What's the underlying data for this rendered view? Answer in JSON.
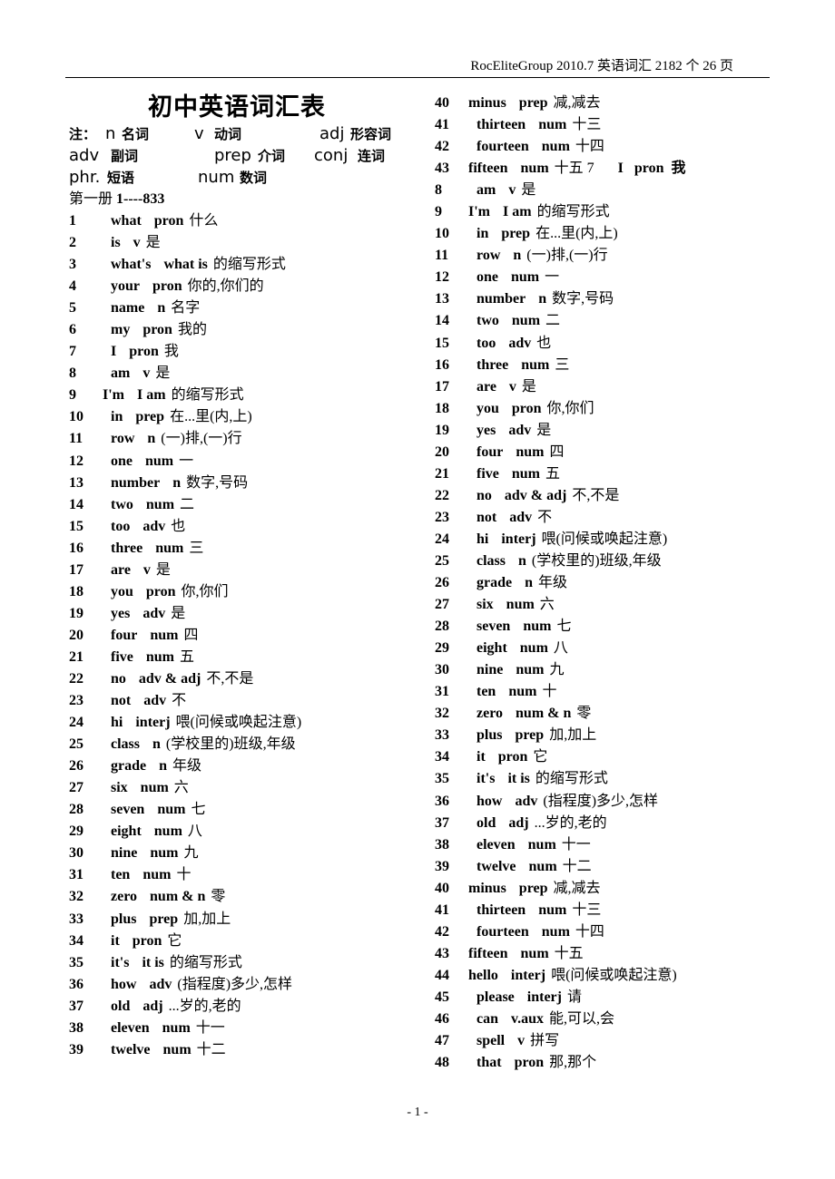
{
  "header": {
    "text": "RocEliteGroup 2010.7   英语词汇 2182 个  26 页"
  },
  "title": "初中英语词汇表",
  "legend": {
    "line1": [
      {
        "abbr": "注：",
        "cn": ""
      },
      {
        "abbr": "n",
        "cn": "名词"
      },
      {
        "abbr": "v",
        "cn": "动词"
      },
      {
        "abbr": "adj",
        "cn": "形容词"
      }
    ],
    "line2": [
      {
        "abbr": "adv",
        "cn": "副词"
      },
      {
        "abbr": "prep",
        "cn": "介词"
      },
      {
        "abbr": "conj",
        "cn": "连词"
      }
    ],
    "line3": [
      {
        "abbr": "phr.",
        "cn": "短语"
      },
      {
        "abbr": "num",
        "cn": "数词"
      }
    ]
  },
  "section": {
    "book": "第一册",
    "range": "1----833"
  },
  "left_entries": [
    {
      "n": "1",
      "word": "what",
      "pos": "pron",
      "meaning": "什么"
    },
    {
      "n": "2",
      "word": "is",
      "pos": "v",
      "meaning": "是"
    },
    {
      "n": "3",
      "word": "what's",
      "pos": "what is",
      "meaning": "的缩写形式"
    },
    {
      "n": "4",
      "word": "your",
      "pos": "pron",
      "meaning": "你的,你们的"
    },
    {
      "n": "5",
      "word": "name",
      "pos": "n",
      "meaning": "名字"
    },
    {
      "n": "6",
      "word": "my",
      "pos": "pron",
      "meaning": "我的"
    },
    {
      "n": "7",
      "word": "I",
      "pos": "pron",
      "meaning": "我"
    },
    {
      "n": "8",
      "word": "am",
      "pos": "v",
      "meaning": "是"
    },
    {
      "n": "9",
      "word": "I'm",
      "pos": "I am",
      "meaning": "的缩写形式",
      "shift": true
    },
    {
      "n": "10",
      "word": "in",
      "pos": "prep",
      "meaning": "在...里(内,上)"
    },
    {
      "n": "11",
      "word": "row",
      "pos": "n",
      "meaning": "(一)排,(一)行"
    },
    {
      "n": "12",
      "word": "one",
      "pos": "num",
      "meaning": "一"
    },
    {
      "n": "13",
      "word": "number",
      "pos": "n",
      "meaning": "数字,号码"
    },
    {
      "n": "14",
      "word": "two",
      "pos": "num",
      "meaning": "二"
    },
    {
      "n": "15",
      "word": "too",
      "pos": "adv",
      "meaning": "也"
    },
    {
      "n": "16",
      "word": "three",
      "pos": "num",
      "meaning": "三"
    },
    {
      "n": "17",
      "word": "are",
      "pos": "v",
      "meaning": "是"
    },
    {
      "n": "18",
      "word": "you",
      "pos": "pron",
      "meaning": "你,你们"
    },
    {
      "n": "19",
      "word": "yes",
      "pos": "adv",
      "meaning": "是"
    },
    {
      "n": "20",
      "word": "four",
      "pos": "num",
      "meaning": "四"
    },
    {
      "n": "21",
      "word": "five",
      "pos": "num",
      "meaning": "五"
    },
    {
      "n": "22",
      "word": "no",
      "pos": "adv & adj",
      "meaning": "不,不是"
    },
    {
      "n": "23",
      "word": "not",
      "pos": "adv",
      "meaning": "不"
    },
    {
      "n": "24",
      "word": "hi",
      "pos": "interj",
      "meaning": "喂(问候或唤起注意)"
    },
    {
      "n": "25",
      "word": "class",
      "pos": "n",
      "meaning": "(学校里的)班级,年级"
    },
    {
      "n": "26",
      "word": "grade",
      "pos": "n",
      "meaning": "年级"
    },
    {
      "n": "27",
      "word": "six",
      "pos": "num",
      "meaning": "六"
    },
    {
      "n": "28",
      "word": "seven",
      "pos": "num",
      "meaning": "七"
    },
    {
      "n": "29",
      "word": "eight",
      "pos": "num",
      "meaning": "八"
    },
    {
      "n": "30",
      "word": "nine",
      "pos": "num",
      "meaning": "九"
    },
    {
      "n": "31",
      "word": "ten",
      "pos": "num",
      "meaning": "十"
    },
    {
      "n": "32",
      "word": "zero",
      "pos": "num & n",
      "meaning": "零"
    },
    {
      "n": "33",
      "word": "plus",
      "pos": "prep",
      "meaning": "加,加上"
    },
    {
      "n": "34",
      "word": "it",
      "pos": "pron",
      "meaning": "它"
    },
    {
      "n": "35",
      "word": "it's",
      "pos": "it is",
      "meaning": "的缩写形式"
    },
    {
      "n": "36",
      "word": "how",
      "pos": "adv",
      "meaning": "(指程度)多少,怎样"
    },
    {
      "n": "37",
      "word": "old",
      "pos": "adj",
      "meaning": "...岁的,老的"
    },
    {
      "n": "38",
      "word": "eleven",
      "pos": "num",
      "meaning": "十一"
    },
    {
      "n": "39",
      "word": "twelve",
      "pos": "num",
      "meaning": "十二"
    }
  ],
  "right_entries": [
    {
      "n": "40",
      "word": "minus",
      "pos": "prep",
      "meaning": "减,减去",
      "shift": true
    },
    {
      "n": "41",
      "word": "thirteen",
      "pos": "num",
      "meaning": "十三"
    },
    {
      "n": "42",
      "word": "fourteen",
      "pos": "num",
      "meaning": "十四"
    },
    {
      "n": "43",
      "word": "fifteen",
      "pos": "num",
      "meaning": "十五 7",
      "extra": "I   pron  我",
      "shift": true
    },
    {
      "n": "8",
      "word": "am",
      "pos": "v",
      "meaning": "是"
    },
    {
      "n": "9",
      "word": "I'm",
      "pos": "I am",
      "meaning": "的缩写形式",
      "shift": true
    },
    {
      "n": "10",
      "word": "in",
      "pos": "prep",
      "meaning": "在...里(内,上)"
    },
    {
      "n": "11",
      "word": "row",
      "pos": "n",
      "meaning": "(一)排,(一)行"
    },
    {
      "n": "12",
      "word": "one",
      "pos": "num",
      "meaning": "一"
    },
    {
      "n": "13",
      "word": "number",
      "pos": "n",
      "meaning": "数字,号码"
    },
    {
      "n": "14",
      "word": "two",
      "pos": "num",
      "meaning": "二"
    },
    {
      "n": "15",
      "word": "too",
      "pos": "adv",
      "meaning": "也"
    },
    {
      "n": "16",
      "word": "three",
      "pos": "num",
      "meaning": "三"
    },
    {
      "n": "17",
      "word": "are",
      "pos": "v",
      "meaning": "是"
    },
    {
      "n": "18",
      "word": "you",
      "pos": "pron",
      "meaning": "你,你们"
    },
    {
      "n": "19",
      "word": "yes",
      "pos": "adv",
      "meaning": "是"
    },
    {
      "n": "20",
      "word": "four",
      "pos": "num",
      "meaning": "四"
    },
    {
      "n": "21",
      "word": "five",
      "pos": "num",
      "meaning": "五"
    },
    {
      "n": "22",
      "word": "no",
      "pos": "adv & adj",
      "meaning": "不,不是"
    },
    {
      "n": "23",
      "word": "not",
      "pos": "adv",
      "meaning": "不"
    },
    {
      "n": "24",
      "word": "hi",
      "pos": "interj",
      "meaning": "喂(问候或唤起注意)"
    },
    {
      "n": "25",
      "word": "class",
      "pos": "n",
      "meaning": "(学校里的)班级,年级"
    },
    {
      "n": "26",
      "word": "grade",
      "pos": "n",
      "meaning": "年级"
    },
    {
      "n": "27",
      "word": "six",
      "pos": "num",
      "meaning": "六"
    },
    {
      "n": "28",
      "word": "seven",
      "pos": "num",
      "meaning": "七"
    },
    {
      "n": "29",
      "word": "eight",
      "pos": "num",
      "meaning": "八"
    },
    {
      "n": "30",
      "word": "nine",
      "pos": "num",
      "meaning": "九"
    },
    {
      "n": "31",
      "word": "ten",
      "pos": "num",
      "meaning": "十"
    },
    {
      "n": "32",
      "word": "zero",
      "pos": "num & n",
      "meaning": "零"
    },
    {
      "n": "33",
      "word": "plus",
      "pos": "prep",
      "meaning": "加,加上"
    },
    {
      "n": "34",
      "word": "it",
      "pos": "pron",
      "meaning": "它"
    },
    {
      "n": "35",
      "word": "it's",
      "pos": "it is",
      "meaning": "的缩写形式"
    },
    {
      "n": "36",
      "word": "how",
      "pos": "adv",
      "meaning": "(指程度)多少,怎样"
    },
    {
      "n": "37",
      "word": "old",
      "pos": "adj",
      "meaning": "...岁的,老的"
    },
    {
      "n": "38",
      "word": "eleven",
      "pos": "num",
      "meaning": "十一"
    },
    {
      "n": "39",
      "word": "twelve",
      "pos": "num",
      "meaning": "十二"
    },
    {
      "n": "40",
      "word": "minus",
      "pos": "prep",
      "meaning": "减,减去",
      "shift": true
    },
    {
      "n": "41",
      "word": "thirteen",
      "pos": "num",
      "meaning": "十三"
    },
    {
      "n": "42",
      "word": "fourteen",
      "pos": "num",
      "meaning": "十四"
    },
    {
      "n": "43",
      "word": "fifteen",
      "pos": "num",
      "meaning": "十五",
      "shift": true
    },
    {
      "n": "44",
      "word": "hello",
      "pos": "interj",
      "meaning": "喂(问候或唤起注意)",
      "shift": true
    },
    {
      "n": "45",
      "word": "please",
      "pos": "interj",
      "meaning": "请"
    },
    {
      "n": "46",
      "word": "can",
      "pos": "v.aux",
      "meaning": "能,可以,会"
    },
    {
      "n": "47",
      "word": "spell",
      "pos": "v",
      "meaning": "拼写"
    },
    {
      "n": "48",
      "word": "that",
      "pos": "pron",
      "meaning": "那,那个"
    }
  ],
  "footer": {
    "page": "- 1 -"
  }
}
